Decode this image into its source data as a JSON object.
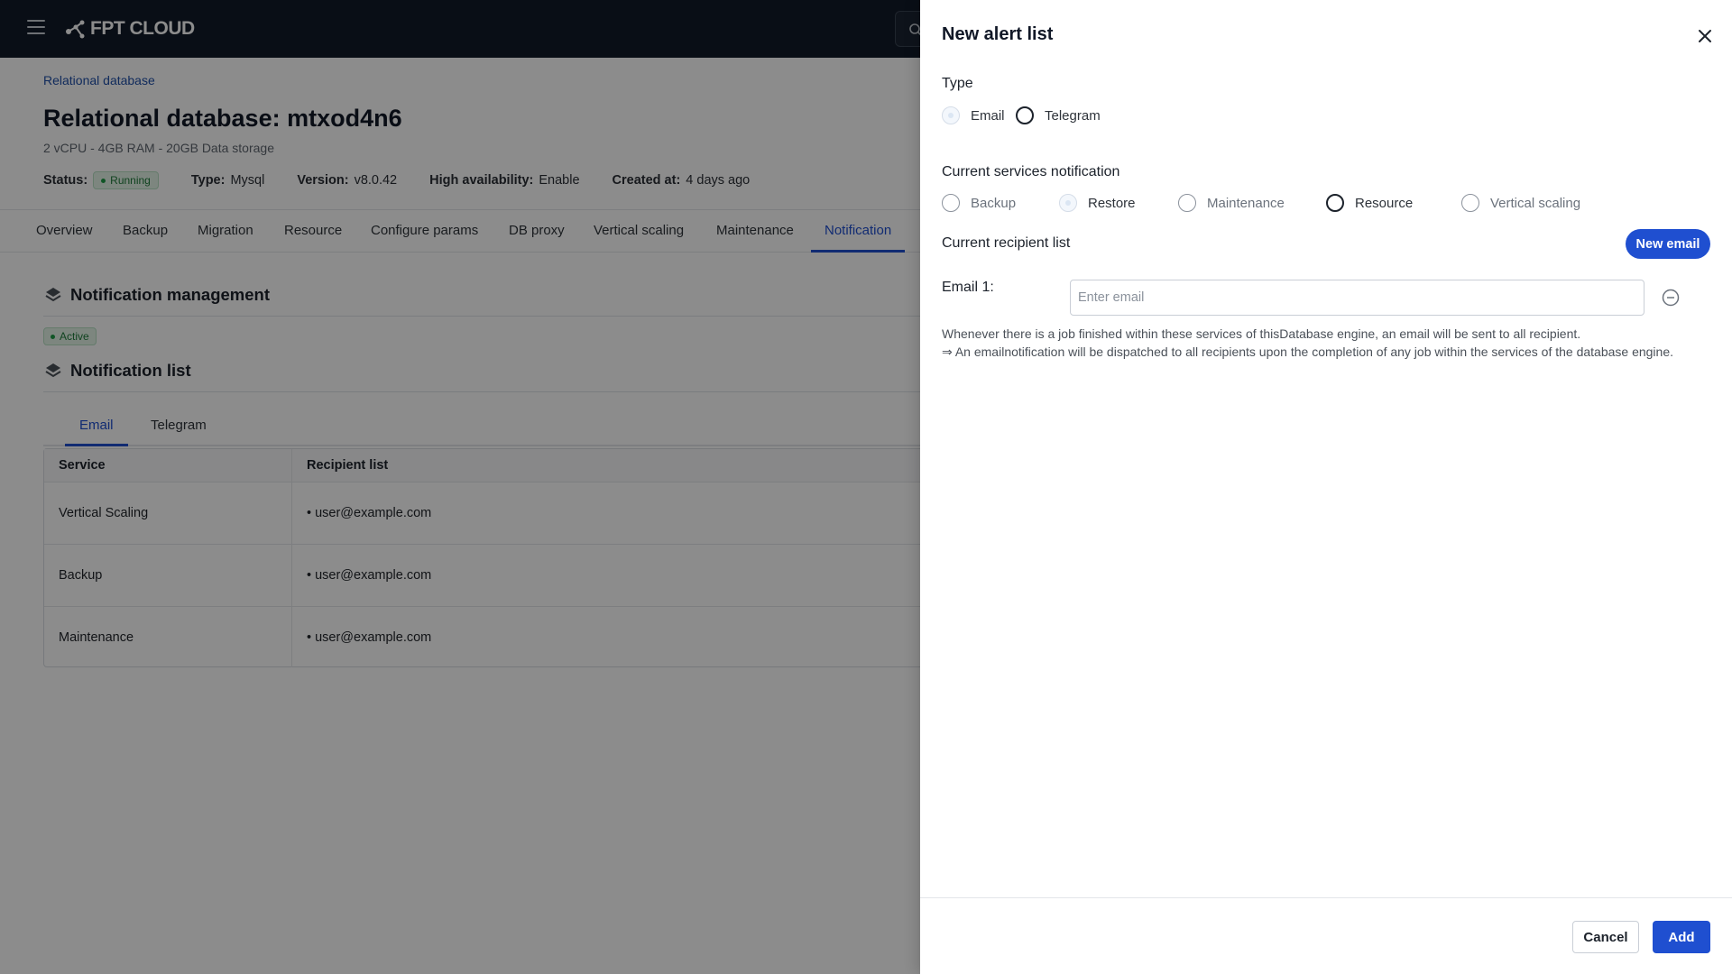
{
  "topbar": {
    "logo_text": "FPT CLOUD"
  },
  "breadcrumb": "Relational database",
  "page": {
    "title": "Relational database: mtxod4n6",
    "subtitle": "2 vCPU - 4GB RAM - 20GB Data storage",
    "meta": {
      "status_label": "Status:",
      "status_value": "Running",
      "type_label": "Type:",
      "type_value": "Mysql",
      "version_label": "Version:",
      "version_value": "v8.0.42",
      "ha_label": "High availability:",
      "ha_value": "Enable",
      "created_label": "Created at:",
      "created_value": "4 days ago"
    }
  },
  "tabs": [
    "Overview",
    "Backup",
    "Migration",
    "Resource",
    "Configure params",
    "DB proxy",
    "Vertical scaling",
    "Maintenance",
    "Notification"
  ],
  "active_tab": "Notification",
  "notification": {
    "management_title": "Notification management",
    "active_badge": "Active",
    "list_title": "Notification list",
    "subtabs": [
      "Email",
      "Telegram"
    ],
    "table": {
      "headers": [
        "Service",
        "Recipient list"
      ],
      "rows": [
        {
          "service": "Vertical Scaling",
          "recipient": "• user@example.com"
        },
        {
          "service": "Backup",
          "recipient": "• user@example.com"
        },
        {
          "service": "Maintenance",
          "recipient": "• user@example.com"
        }
      ]
    }
  },
  "drawer": {
    "title": "New alert list",
    "type_label": "Type",
    "type_options": [
      "Email",
      "Telegram"
    ],
    "services_label": "Current services notification",
    "service_options": [
      "Backup",
      "Restore",
      "Maintenance",
      "Resource",
      "Vertical scaling"
    ],
    "recipient_label": "Current recipient list",
    "new_email_button": "New email",
    "email_1_label": "Email 1:",
    "email_placeholder": "Enter email",
    "email_value": "",
    "help_line_1": "Whenever there is a job finished within these services of thisDatabase engine, an email will be sent to all recipient.",
    "help_line_2": "⇒ An emailnotification will be dispatched to all recipients upon the completion of any job within the services of the database engine.",
    "cancel_button": "Cancel",
    "add_button": "Add"
  },
  "colors": {
    "accent": "#1f4fd0",
    "topbar": "#111a28",
    "success": "#1e7b3a"
  }
}
